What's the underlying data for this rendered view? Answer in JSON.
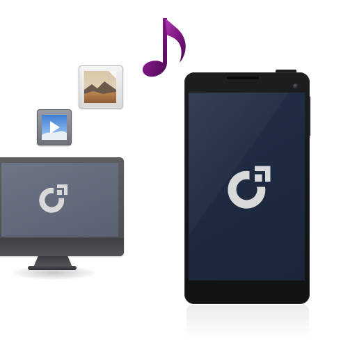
{
  "scene": {
    "description_icons": [
      "music-note-icon",
      "photo-file-icon",
      "video-file-icon",
      "app-logo-icon"
    ],
    "colors": {
      "background": "#ffffff",
      "music_note": "#7b1580",
      "monitor_screen": "#6a7282",
      "phone_screen": "#1f2a40",
      "logo": "#d9d9d9"
    }
  }
}
